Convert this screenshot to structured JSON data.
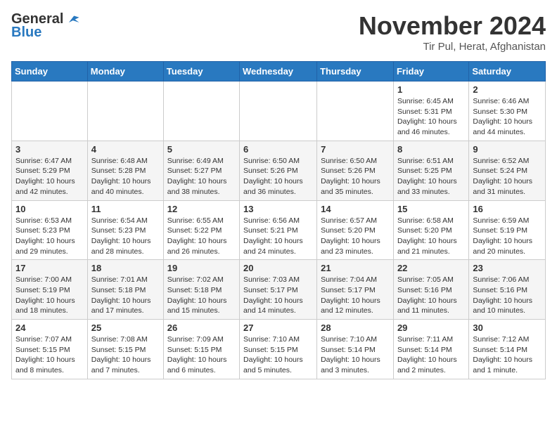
{
  "header": {
    "logo_general": "General",
    "logo_blue": "Blue",
    "month": "November 2024",
    "location": "Tir Pul, Herat, Afghanistan"
  },
  "weekdays": [
    "Sunday",
    "Monday",
    "Tuesday",
    "Wednesday",
    "Thursday",
    "Friday",
    "Saturday"
  ],
  "weeks": [
    [
      {
        "day": "",
        "info": ""
      },
      {
        "day": "",
        "info": ""
      },
      {
        "day": "",
        "info": ""
      },
      {
        "day": "",
        "info": ""
      },
      {
        "day": "",
        "info": ""
      },
      {
        "day": "1",
        "info": "Sunrise: 6:45 AM\nSunset: 5:31 PM\nDaylight: 10 hours\nand 46 minutes."
      },
      {
        "day": "2",
        "info": "Sunrise: 6:46 AM\nSunset: 5:30 PM\nDaylight: 10 hours\nand 44 minutes."
      }
    ],
    [
      {
        "day": "3",
        "info": "Sunrise: 6:47 AM\nSunset: 5:29 PM\nDaylight: 10 hours\nand 42 minutes."
      },
      {
        "day": "4",
        "info": "Sunrise: 6:48 AM\nSunset: 5:28 PM\nDaylight: 10 hours\nand 40 minutes."
      },
      {
        "day": "5",
        "info": "Sunrise: 6:49 AM\nSunset: 5:27 PM\nDaylight: 10 hours\nand 38 minutes."
      },
      {
        "day": "6",
        "info": "Sunrise: 6:50 AM\nSunset: 5:26 PM\nDaylight: 10 hours\nand 36 minutes."
      },
      {
        "day": "7",
        "info": "Sunrise: 6:50 AM\nSunset: 5:26 PM\nDaylight: 10 hours\nand 35 minutes."
      },
      {
        "day": "8",
        "info": "Sunrise: 6:51 AM\nSunset: 5:25 PM\nDaylight: 10 hours\nand 33 minutes."
      },
      {
        "day": "9",
        "info": "Sunrise: 6:52 AM\nSunset: 5:24 PM\nDaylight: 10 hours\nand 31 minutes."
      }
    ],
    [
      {
        "day": "10",
        "info": "Sunrise: 6:53 AM\nSunset: 5:23 PM\nDaylight: 10 hours\nand 29 minutes."
      },
      {
        "day": "11",
        "info": "Sunrise: 6:54 AM\nSunset: 5:23 PM\nDaylight: 10 hours\nand 28 minutes."
      },
      {
        "day": "12",
        "info": "Sunrise: 6:55 AM\nSunset: 5:22 PM\nDaylight: 10 hours\nand 26 minutes."
      },
      {
        "day": "13",
        "info": "Sunrise: 6:56 AM\nSunset: 5:21 PM\nDaylight: 10 hours\nand 24 minutes."
      },
      {
        "day": "14",
        "info": "Sunrise: 6:57 AM\nSunset: 5:20 PM\nDaylight: 10 hours\nand 23 minutes."
      },
      {
        "day": "15",
        "info": "Sunrise: 6:58 AM\nSunset: 5:20 PM\nDaylight: 10 hours\nand 21 minutes."
      },
      {
        "day": "16",
        "info": "Sunrise: 6:59 AM\nSunset: 5:19 PM\nDaylight: 10 hours\nand 20 minutes."
      }
    ],
    [
      {
        "day": "17",
        "info": "Sunrise: 7:00 AM\nSunset: 5:19 PM\nDaylight: 10 hours\nand 18 minutes."
      },
      {
        "day": "18",
        "info": "Sunrise: 7:01 AM\nSunset: 5:18 PM\nDaylight: 10 hours\nand 17 minutes."
      },
      {
        "day": "19",
        "info": "Sunrise: 7:02 AM\nSunset: 5:18 PM\nDaylight: 10 hours\nand 15 minutes."
      },
      {
        "day": "20",
        "info": "Sunrise: 7:03 AM\nSunset: 5:17 PM\nDaylight: 10 hours\nand 14 minutes."
      },
      {
        "day": "21",
        "info": "Sunrise: 7:04 AM\nSunset: 5:17 PM\nDaylight: 10 hours\nand 12 minutes."
      },
      {
        "day": "22",
        "info": "Sunrise: 7:05 AM\nSunset: 5:16 PM\nDaylight: 10 hours\nand 11 minutes."
      },
      {
        "day": "23",
        "info": "Sunrise: 7:06 AM\nSunset: 5:16 PM\nDaylight: 10 hours\nand 10 minutes."
      }
    ],
    [
      {
        "day": "24",
        "info": "Sunrise: 7:07 AM\nSunset: 5:15 PM\nDaylight: 10 hours\nand 8 minutes."
      },
      {
        "day": "25",
        "info": "Sunrise: 7:08 AM\nSunset: 5:15 PM\nDaylight: 10 hours\nand 7 minutes."
      },
      {
        "day": "26",
        "info": "Sunrise: 7:09 AM\nSunset: 5:15 PM\nDaylight: 10 hours\nand 6 minutes."
      },
      {
        "day": "27",
        "info": "Sunrise: 7:10 AM\nSunset: 5:15 PM\nDaylight: 10 hours\nand 5 minutes."
      },
      {
        "day": "28",
        "info": "Sunrise: 7:10 AM\nSunset: 5:14 PM\nDaylight: 10 hours\nand 3 minutes."
      },
      {
        "day": "29",
        "info": "Sunrise: 7:11 AM\nSunset: 5:14 PM\nDaylight: 10 hours\nand 2 minutes."
      },
      {
        "day": "30",
        "info": "Sunrise: 7:12 AM\nSunset: 5:14 PM\nDaylight: 10 hours\nand 1 minute."
      }
    ]
  ]
}
